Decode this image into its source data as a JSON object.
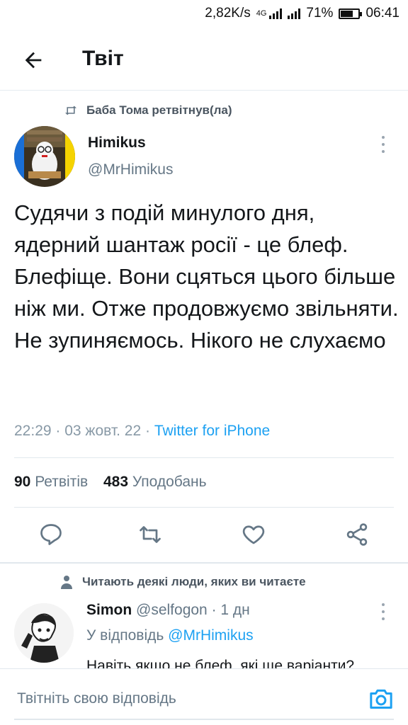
{
  "status_bar": {
    "speed": "2,82K/s",
    "network": "4G",
    "battery": "71%",
    "battery_level": 0.71,
    "time": "06:41"
  },
  "header": {
    "title": "Твіт"
  },
  "tweet": {
    "retweeted_by": "Баба Тома ретвітнув(ла)",
    "author_name": "Himikus",
    "author_handle": "@MrHimikus",
    "text": "Судячи з подій минулого дня, ядерний шантаж росії - це блеф. Блефіще. Вони сцяться цього більше ніж ми. Отже продовжуємо звільняти. Не зупиняємось. Нікого не слухаємо",
    "timestamp": "22:29 · 03 жовт. 22 · ",
    "source": "Twitter for iPhone",
    "retweets_count": "90",
    "retweets_label": "Ретвітів",
    "likes_count": "483",
    "likes_label": "Уподобань"
  },
  "reply_context": "Читають деякі люди, яких ви читаєте",
  "reply": {
    "author_name": "Simon",
    "author_handle": "@selfogon",
    "time": "· 1 дн",
    "replying_to_label": "У відповідь ",
    "replying_to_handle": "@MrHimikus",
    "text": "Навіть якщо не блеф, які ще варіанти?"
  },
  "composer": {
    "placeholder": "Твітніть свою відповідь"
  },
  "colors": {
    "accent": "#1da1f2",
    "text": "#14171a",
    "secondary": "#657786"
  }
}
